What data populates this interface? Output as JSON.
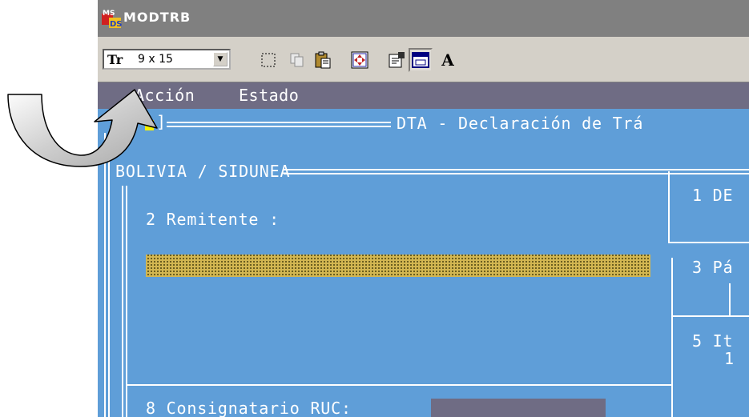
{
  "window": {
    "title": "MODTRB",
    "icon": "app-icon"
  },
  "toolbar": {
    "font_glyph": "Tr",
    "font_size": "9 x 15",
    "dropdown_arrow": "▼",
    "buttons": [
      "select-icon",
      "copy-icon",
      "paste-icon",
      "fullscreen-icon",
      "properties-icon",
      "background-icon",
      "font-icon"
    ],
    "font_button_label": "A"
  },
  "menu": {
    "items": [
      "Acción",
      "Estado"
    ]
  },
  "console": {
    "frame_title": "DTA - Declaración de Trá",
    "section_header": "BOLIVIA / SIDUNEA",
    "remitente_label": "2 Remitente :",
    "box1_label": "1 DE",
    "box3_label": "3 Pá",
    "box5_label": "5 It",
    "box5_value": "1",
    "consignatario_label": "8 Consignatario RUC:"
  },
  "colors": {
    "console_bg": "#5f9ed8",
    "menubar_bg": "#6f6c84",
    "titlebar_bg": "#808080",
    "hatch": "#d9b84a"
  }
}
